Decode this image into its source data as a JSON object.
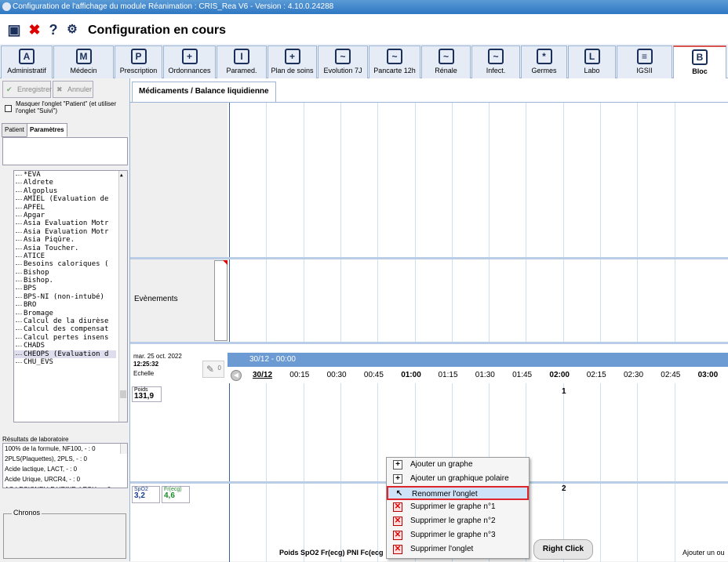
{
  "window_title": "Configuration de l'affichage du module Réanimation : CRIS_Rea V6 - Version : 4.10.0.24288",
  "toolbar": {
    "title": "Configuration en cours"
  },
  "tabs": [
    {
      "label": "Administratif",
      "icon": "A"
    },
    {
      "label": "Médecin",
      "icon": "M"
    },
    {
      "label": "Prescription",
      "icon": "P"
    },
    {
      "label": "Ordonnances",
      "icon": "+"
    },
    {
      "label": "Paramed.",
      "icon": "I"
    },
    {
      "label": "Plan de soins",
      "icon": "+"
    },
    {
      "label": "Evolution 7J",
      "icon": "~"
    },
    {
      "label": "Pancarte 12h",
      "icon": "~"
    },
    {
      "label": "Rénale",
      "icon": "~"
    },
    {
      "label": "Infect.",
      "icon": "~"
    },
    {
      "label": "Germes",
      "icon": "*"
    },
    {
      "label": "Labo",
      "icon": "L"
    },
    {
      "label": "IGSII",
      "icon": "≡"
    },
    {
      "label": "Bloc",
      "icon": "B"
    }
  ],
  "left": {
    "save_label": "Enregistrer",
    "cancel_label": "Annuler",
    "hide_patient_label": "Masquer l'onglet \"Patient\" (et utiliser l'onglet \"Suivi\")",
    "subtab_patient": "Patient",
    "subtab_params": "Paramètres",
    "items": [
      "*EVA",
      "Aldrete",
      "Algoplus",
      "AMIEL (Evaluation de",
      "APFEL",
      "Apgar",
      "Asia Evaluation Motr",
      "Asia Evaluation Motr",
      "Asia Piqûre.",
      "Asia Toucher.",
      "ATICE",
      "Besoins caloriques (",
      "Bishop",
      "Bishop.",
      "BPS",
      "BPS-NI (non-intubé)",
      "BRO",
      "Bromage",
      "Calcul de la diurèse",
      "Calcul des compensat",
      "Calcul pertes insens",
      "CHADS",
      "CHEOPS (Evaluation d",
      "CHU_EVS"
    ],
    "lab_title": "Résultats de laboratoire",
    "lab_items": [
      "100% de la formule, NF100,  - : 0",
      "2PLS(Plaquettes), 2PLS,  - : 0",
      "Acide lactique, LACT,  - : 0",
      "Acide Urique, URCR4,  - : 0",
      "AG LEGIONELLE URINE, LEGU,  - : 0"
    ],
    "chronos_label": "Chronos"
  },
  "main": {
    "tab_label": "Médicaments / Balance liquidienne",
    "evenements_label": "Evènements",
    "date_label": "mar. 25 oct. 2022",
    "time_label": "12:25:32",
    "echelle_label": "Echelle",
    "pen_count": "0",
    "date_range": "30/12 - 00:00",
    "time_ticks": [
      {
        "t": "30/12",
        "bold": true,
        "u": true
      },
      {
        "t": "00:15",
        "bold": false
      },
      {
        "t": "00:30",
        "bold": false
      },
      {
        "t": "00:45",
        "bold": false
      },
      {
        "t": "01:00",
        "bold": true
      },
      {
        "t": "01:15",
        "bold": false
      },
      {
        "t": "01:30",
        "bold": false
      },
      {
        "t": "01:45",
        "bold": false
      },
      {
        "t": "02:00",
        "bold": true
      },
      {
        "t": "02:15",
        "bold": false
      },
      {
        "t": "02:30",
        "bold": false
      },
      {
        "t": "02:45",
        "bold": false
      },
      {
        "t": "03:00",
        "bold": true
      }
    ],
    "poids_label": "Poids",
    "poids_value": "131,9",
    "graph1_num": "1",
    "graph2_num": "2",
    "spo2_label": "SpO2",
    "spo2_value": "3,2",
    "frecg_label": "Fr(ecg)",
    "frecg_value": "4,6",
    "bottom_labels": "Poids   SpO2 Fr(ecg)   PNI Fc(ecg",
    "bottom_right": "Ajouter un ou"
  },
  "context_menu": [
    {
      "label": "Ajouter un graphe",
      "icon": "plus"
    },
    {
      "label": "Ajouter un graphique polaire",
      "icon": "plus"
    },
    {
      "label": "Renommer l'onglet",
      "icon": "cursor",
      "highlight": true
    },
    {
      "label": "Supprimer le graphe n°1",
      "icon": "x"
    },
    {
      "label": "Supprimer le graphe n°2",
      "icon": "x"
    },
    {
      "label": "Supprimer le graphe n°3",
      "icon": "x"
    },
    {
      "label": "Supprimer l'onglet",
      "icon": "x"
    }
  ],
  "right_click_label": "Right Click",
  "colors": {
    "titlebar": "#2f77c4",
    "accent_blue": "#6c9bd3",
    "highlight_red": "#e0242b"
  }
}
